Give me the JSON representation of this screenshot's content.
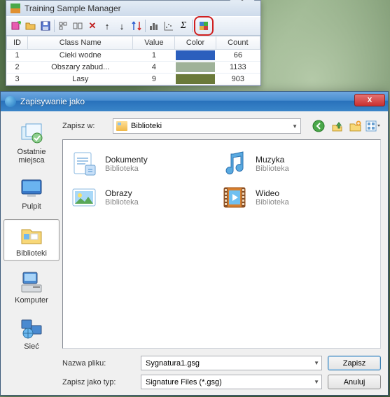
{
  "tsm": {
    "title": "Training Sample Manager",
    "close_glyph": "×",
    "columns": {
      "id": "ID",
      "class": "Class Name",
      "value": "Value",
      "color": "Color",
      "count": "Count"
    },
    "rows": [
      {
        "id": "1",
        "class": "Cieki wodne",
        "value": "1",
        "color": "#2b5fbd",
        "count": "66"
      },
      {
        "id": "2",
        "class": "Obszary zabud...",
        "value": "4",
        "color": "#9fb299",
        "count": "1133"
      },
      {
        "id": "3",
        "class": "Lasy",
        "value": "9",
        "color": "#6b7a3a",
        "count": "903"
      }
    ]
  },
  "saveas": {
    "title": "Zapisywanie jako",
    "close_glyph": "X",
    "lookin_label": "Zapisz w:",
    "lookin_value": "Biblioteki",
    "sidebar": [
      {
        "label": "Ostatnie miejsca"
      },
      {
        "label": "Pulpit"
      },
      {
        "label": "Biblioteki"
      },
      {
        "label": "Komputer"
      },
      {
        "label": "Sieć"
      }
    ],
    "libraries": [
      {
        "name": "Dokumenty",
        "sub": "Biblioteka"
      },
      {
        "name": "Muzyka",
        "sub": "Biblioteka"
      },
      {
        "name": "Obrazy",
        "sub": "Biblioteka"
      },
      {
        "name": "Wideo",
        "sub": "Biblioteka"
      }
    ],
    "filename_label": "Nazwa pliku:",
    "filename_value": "Sygnatura1.gsg",
    "filetype_label": "Zapisz jako typ:",
    "filetype_value": "Signature Files (*.gsg)",
    "save_btn": "Zapisz",
    "cancel_btn": "Anuluj"
  }
}
